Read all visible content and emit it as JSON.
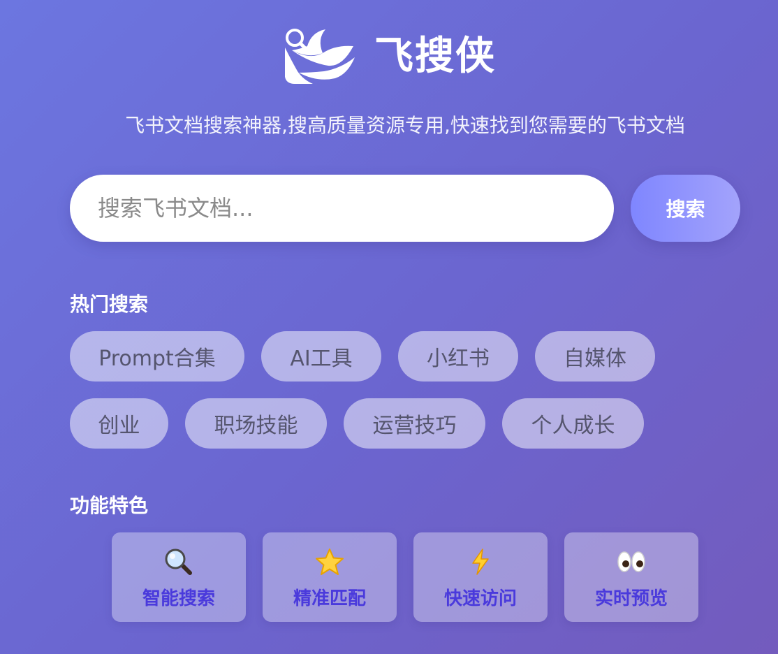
{
  "app": {
    "title": "飞搜侠",
    "tagline": "飞书文档搜索神器,搜高质量资源专用,快速找到您需要的飞书文档",
    "logo_icon": "bird-magnifier-logo-icon"
  },
  "search": {
    "placeholder": "搜索飞书文档...",
    "value": "",
    "button_label": "搜索"
  },
  "hot_search": {
    "title": "热门搜索",
    "tags": [
      "Prompt合集",
      "AI工具",
      "小红书",
      "自媒体",
      "创业",
      "职场技能",
      "运营技巧",
      "个人成长"
    ]
  },
  "features": {
    "title": "功能特色",
    "items": [
      {
        "label": "智能搜索",
        "icon": "magnifier-icon"
      },
      {
        "label": "精准匹配",
        "icon": "star-icon"
      },
      {
        "label": "快速访问",
        "icon": "lightning-icon"
      },
      {
        "label": "实时预览",
        "icon": "eyes-icon"
      }
    ]
  },
  "colors": {
    "background_start": "#6c76e0",
    "background_end": "#735bbd",
    "feature_label": "#4a3adc",
    "tag_text": "#55556e"
  }
}
